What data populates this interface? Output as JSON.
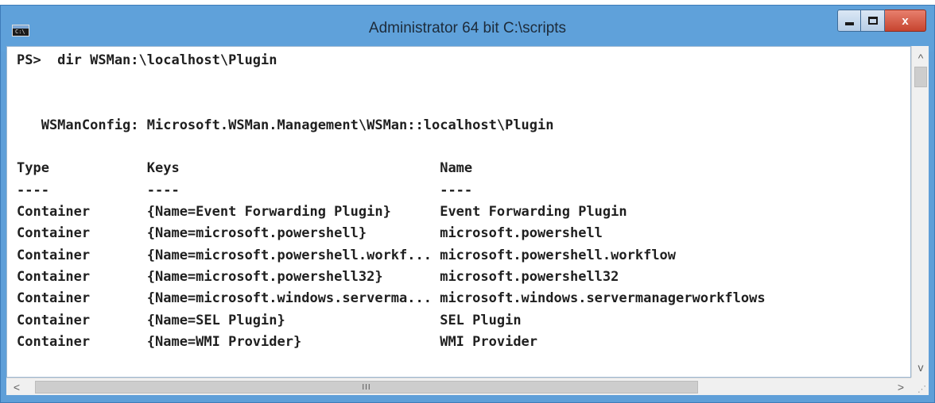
{
  "window": {
    "title": "Administrator 64 bit C:\\scripts",
    "icon": "console-icon",
    "controls": {
      "minimize": "minimize-icon",
      "maximize": "maximize-icon",
      "close_glyph": "x"
    }
  },
  "console": {
    "lines": [
      "PS>  dir WSMan:\\localhost\\Plugin",
      "",
      "",
      "   WSManConfig: Microsoft.WSMan.Management\\WSMan::localhost\\Plugin",
      "",
      "Type            Keys                                Name",
      "----            ----                                ----",
      "Container       {Name=Event Forwarding Plugin}      Event Forwarding Plugin",
      "Container       {Name=microsoft.powershell}         microsoft.powershell",
      "Container       {Name=microsoft.powershell.workf... microsoft.powershell.workflow",
      "Container       {Name=microsoft.powershell32}       microsoft.powershell32",
      "Container       {Name=microsoft.windows.serverma... microsoft.windows.servermanagerworkflows",
      "Container       {Name=SEL Plugin}                   SEL Plugin",
      "Container       {Name=WMI Provider}                 WMI Provider"
    ]
  },
  "scrollbars": {
    "vertical_up": "^",
    "vertical_down": "v",
    "horizontal_left": "<",
    "horizontal_right": ">",
    "grip": "III"
  }
}
